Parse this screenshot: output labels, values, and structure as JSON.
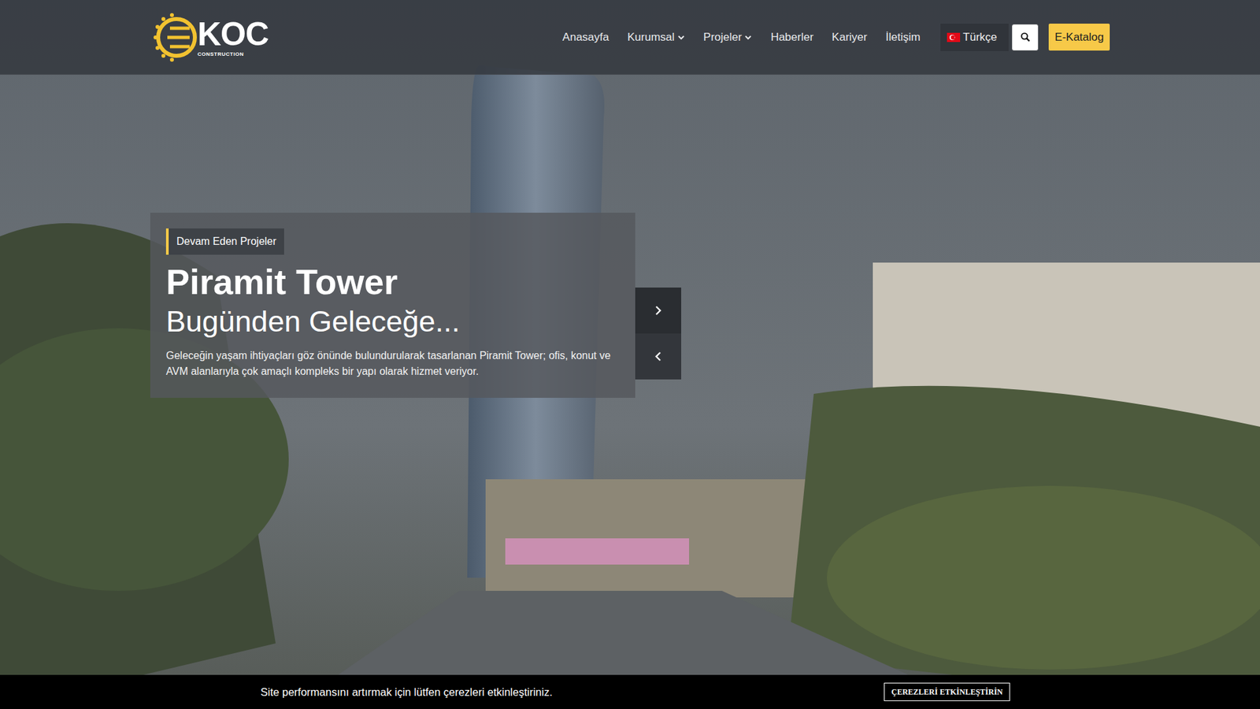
{
  "logo": {
    "text": "KOC",
    "subtext": "CONSTRUCTION"
  },
  "nav": {
    "items": [
      {
        "label": "Anasayfa",
        "has_menu": false
      },
      {
        "label": "Kurumsal",
        "has_menu": true
      },
      {
        "label": "Projeler",
        "has_menu": true
      },
      {
        "label": "Haberler",
        "has_menu": false
      },
      {
        "label": "Kariyer",
        "has_menu": false
      },
      {
        "label": "İletişim",
        "has_menu": false
      }
    ],
    "language": "Türkçe",
    "catalog_button": "E-Katalog"
  },
  "hero": {
    "badge": "Devam Eden Projeler",
    "title": "Piramit Tower",
    "subtitle": "Bugünden Geleceğe...",
    "description": "Geleceğin yaşam ihtiyaçları göz önünde bulundurularak tasarlanan Piramit Tower; ofis, konut ve AVM alanlarıyla çok amaçlı kompleks bir yapı olarak hizmet veriyor."
  },
  "cookie": {
    "message": "Site performansını artırmak için lütfen çerezleri etkinleştiriniz.",
    "button": "ÇEREZLERİ ETKİNLEŞTİRİN"
  }
}
